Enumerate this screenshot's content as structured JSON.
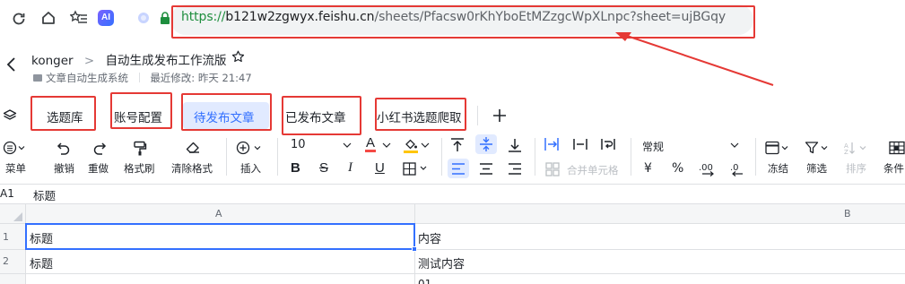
{
  "browser": {
    "url_scheme": "https://",
    "url_host": "b121w2zgwyx.feishu.cn",
    "url_path": "/sheets/Pfacsw0rKhYboEtMZzgcWpXLnpc?sheet=ujBGqy",
    "ai_badge": "AI"
  },
  "doc": {
    "owner": "konger",
    "separator": ">",
    "title": "自动生成发布工作流版",
    "folder": "文章自动生成系统",
    "modified": "最近修改: 昨天 21:47"
  },
  "tabs": [
    {
      "label": "选题库"
    },
    {
      "label": "账号配置"
    },
    {
      "label": "待发布文章",
      "active": true
    },
    {
      "label": "已发布文章"
    },
    {
      "label": "小红书选题爬取"
    }
  ],
  "toolbar": {
    "menu": "菜单",
    "undo": "撤销",
    "redo": "重做",
    "format_painter": "格式刷",
    "clear_format": "清除格式",
    "insert": "插入",
    "font_size": "10",
    "merge_cells": "合并单元格",
    "number_format": "常规",
    "currency": "¥",
    "percent": "%",
    "freeze": "冻结",
    "filter": "筛选",
    "sort": "排序",
    "condition": "条件"
  },
  "formula_bar": {
    "cell_ref": "A1",
    "content": "标题"
  },
  "grid": {
    "columns": [
      "A",
      "B"
    ],
    "rows": [
      {
        "num": "1",
        "cells": [
          "标题",
          "内容"
        ]
      },
      {
        "num": "2",
        "cells": [
          "标题",
          "测试内容"
        ]
      }
    ],
    "partial_text": "01"
  },
  "colors": {
    "annotation_red": "#e53935",
    "accent_blue": "#3370ff",
    "active_tab_bg": "#e1eaff"
  }
}
